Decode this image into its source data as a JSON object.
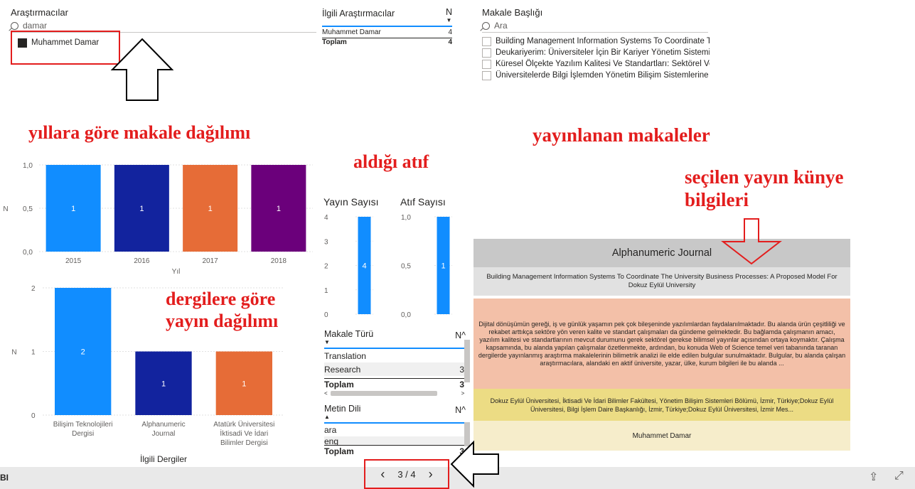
{
  "researchers_slicer": {
    "title": "Araştırmacılar",
    "search_value": "damar",
    "items": [
      "Muhammet Damar"
    ]
  },
  "related_researchers": {
    "col_name": "İlgili Araştırmacılar",
    "col_n": "N",
    "rows": [
      {
        "name": "Muhammet Damar",
        "n": "4"
      }
    ],
    "total_label": "Toplam",
    "total_n": "4"
  },
  "article_title_slicer": {
    "title": "Makale Başlığı",
    "search_placeholder": "Ara",
    "items": [
      "Building Management Information Systems To Coordinate The University Business Pro...",
      "Deukariyerim: Üniversiteler İçin Bir Kariyer Yönetim Sistemi",
      "Küresel Ölçekte Yazılım Kalitesi Ve Standartları: Sektörel Ve Bilimsel Perspektiften Liter...",
      "Üniversitelerde Bilgi İşlemden Yönetim Bilişim Sistemlerine Geçiş: Mevcut Durum Ve B..."
    ]
  },
  "annotations": {
    "by_year": "yıllara göre makale dağılımı",
    "citations": "aldığı atıf",
    "published": "yayınlanan makaleler",
    "selected_info_1": "seçilen yayın künye",
    "selected_info_2": "bilgileri",
    "by_journal_1": "dergilere göre",
    "by_journal_2": "yayın dağılımı"
  },
  "chart_data": [
    {
      "type": "bar",
      "categories": [
        "2015",
        "2016",
        "2017",
        "2018"
      ],
      "values": [
        1,
        1,
        1,
        1
      ],
      "xlabel": "Yıl",
      "ylabel": "N",
      "ylim": [
        0,
        1
      ],
      "yticks": [
        "0,0",
        "0,5",
        "1,0"
      ],
      "colors": [
        "#118dff",
        "#12239e",
        "#e66c37",
        "#6b007b"
      ]
    },
    {
      "type": "bar",
      "categories": [
        "Bilişim Teknolojileri Dergisi",
        "Alphanumeric Journal",
        "Atatürk Üniversitesi İktisadi Ve İdari Bilimler Dergisi"
      ],
      "values": [
        2,
        1,
        1
      ],
      "xlabel": "İlgili Dergiler",
      "ylabel": "N",
      "ylim": [
        0,
        2
      ],
      "yticks": [
        "0",
        "1",
        "2"
      ],
      "colors": [
        "#118dff",
        "#12239e",
        "#e66c37"
      ]
    },
    {
      "type": "bar",
      "title": "Yayın Sayısı",
      "values": [
        4
      ],
      "ylim": [
        0,
        4
      ],
      "yticks": [
        "0",
        "1",
        "2",
        "3",
        "4"
      ],
      "colors": [
        "#118dff"
      ]
    },
    {
      "type": "bar",
      "title": "Atıf Sayısı",
      "values": [
        1
      ],
      "ylim": [
        0,
        1
      ],
      "yticks": [
        "0,0",
        "0,5",
        "1,0"
      ],
      "colors": [
        "#118dff"
      ]
    }
  ],
  "article_type": {
    "col_name": "Makale Türü",
    "col_n": "N",
    "rows": [
      {
        "name": "Translation",
        "n": ""
      },
      {
        "name": "Research",
        "n": "3"
      }
    ],
    "total_label": "Toplam",
    "total_n": "3"
  },
  "text_language": {
    "col_name": "Metin Dili",
    "col_n": "N",
    "rows": [
      {
        "name": "ara",
        "n": ""
      },
      {
        "name": "eng",
        "n": ""
      }
    ],
    "total_label": "Toplam",
    "total_n": "3"
  },
  "info_card": {
    "journal": "Alphanumeric Journal",
    "title": "Building Management Information Systems To  Coordinate The University Business Processes: A Proposed Model For Dokuz Eylül University",
    "abstract": "Dijital dönüşümün gereği, iş ve günlük yaşamın pek çok bileşeninde yazılımlardan faydalanılmaktadır. Bu alanda ürün çeşitliliği ve rekabet arttıkça sektöre yön veren kalite ve standart çalışmaları da gündeme gelmektedir. Bu bağlamda çalışmanın amacı, yazılım kalitesi ve standartlarının mevcut durumunu gerek sektörel gerekse bilimsel yayınlar açısından ortaya koymaktır. Çalışma kapsamında, bu alanda yapılan çalışmalar özetlenmekte, ardından, bu konuda Web of Science temel veri tabanında taranan dergilerde yayınlanmış araştırma makalelerinin bilimetrik analizi ile elde edilen bulgular sunulmaktadır. Bulgular, bu alanda çalışan araştırmacılara, alandaki en aktif üniversite, yazar, ülke, kurum bilgileri ile bu alanda ...",
    "affiliation": "Dokuz Eylül Üniversitesi, İktisadi Ve İdari Bilimler Fakültesi, Yönetim Bilişim Sistemleri Bölümü, İzmir, Türkiye;Dokuz Eylül Üniversitesi, Bilgi İşlem Daire Başkanlığı, İzmir, Türkiye;Dokuz Eylül Üniversitesi, İzmir Mes...",
    "author": "Muhammet Damar"
  },
  "footer": {
    "brand": "BI",
    "page_indicator": "3 / 4"
  }
}
